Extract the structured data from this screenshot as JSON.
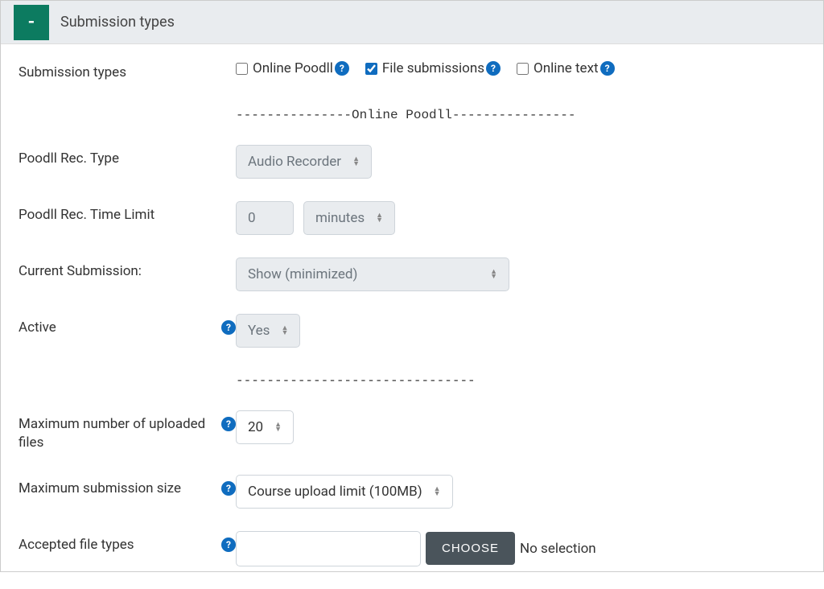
{
  "section": {
    "toggle_symbol": "-",
    "title": "Submission types"
  },
  "fields": {
    "submission_types": {
      "label": "Submission types",
      "options": {
        "online_poodll": {
          "label": "Online Poodll",
          "checked": false
        },
        "file_submissions": {
          "label": "File submissions",
          "checked": true
        },
        "online_text": {
          "label": "Online text",
          "checked": false
        }
      }
    },
    "divider1": "---------------Online Poodll----------------",
    "poodll_rec_type": {
      "label": "Poodll Rec. Type",
      "value": "Audio Recorder"
    },
    "poodll_time_limit": {
      "label": "Poodll Rec. Time Limit",
      "value": "0",
      "unit": "minutes"
    },
    "current_submission": {
      "label": "Current Submission:",
      "value": "Show (minimized)"
    },
    "active": {
      "label": "Active",
      "value": "Yes"
    },
    "divider2": "-------------------------------",
    "max_files": {
      "label": "Maximum number of uploaded files",
      "value": "20"
    },
    "max_size": {
      "label": "Maximum submission size",
      "value": "Course upload limit (100MB)"
    },
    "accepted_types": {
      "label": "Accepted file types",
      "button": "CHOOSE",
      "placeholder_text": "No selection"
    }
  },
  "help_glyph": "?"
}
